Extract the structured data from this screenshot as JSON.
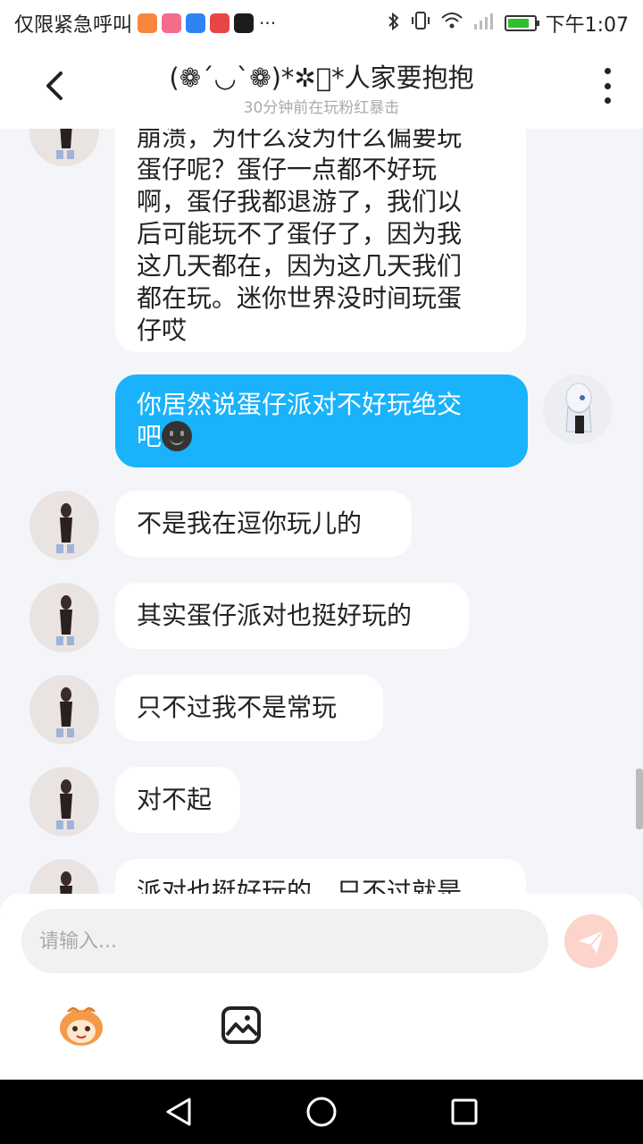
{
  "status_bar": {
    "left_text": "仅限紧急呼叫",
    "time": "下午1:07",
    "battery_level": 0.85,
    "colors": {
      "app1": "#f7863c",
      "app2": "#f36c8a",
      "app3": "#2e84f5",
      "app4": "#e84545",
      "app5": "#1c1c1c"
    }
  },
  "header": {
    "title": "(❁´◡`❁)*✲ﾟ*人家要抱抱",
    "subtitle": "30分钟前在玩粉红暴击"
  },
  "messages": [
    {
      "side": "other",
      "lines": [
        "崩溃，为什么没为什么偏要玩",
        "蛋仔呢？蛋仔一点都不好玩",
        "啊，蛋仔我都退游了，我们以",
        "后可能玩不了蛋仔了，因为我",
        "这几天都在，因为这几天我们",
        "都在玩。迷你世界没时间玩蛋",
        "仔哎"
      ]
    },
    {
      "side": "me",
      "lines": [
        "你居然说蛋仔派对不好玩绝交",
        "吧"
      ],
      "emoji": "smiling-face-emoji"
    },
    {
      "side": "other",
      "lines": [
        "不是我在逗你玩儿的"
      ]
    },
    {
      "side": "other",
      "lines": [
        "其实蛋仔派对也挺好玩的"
      ]
    },
    {
      "side": "other",
      "lines": [
        "只不过我不是常玩"
      ]
    },
    {
      "side": "other",
      "lines": [
        "对不起"
      ]
    },
    {
      "side": "other",
      "lines": [
        "派对也挺好玩的，只不过就是"
      ]
    }
  ],
  "input": {
    "placeholder": "请输入..."
  },
  "colors": {
    "accent": "#1ab2fa",
    "send_button": "#fcd4cc",
    "background": "#f4f5f9"
  }
}
